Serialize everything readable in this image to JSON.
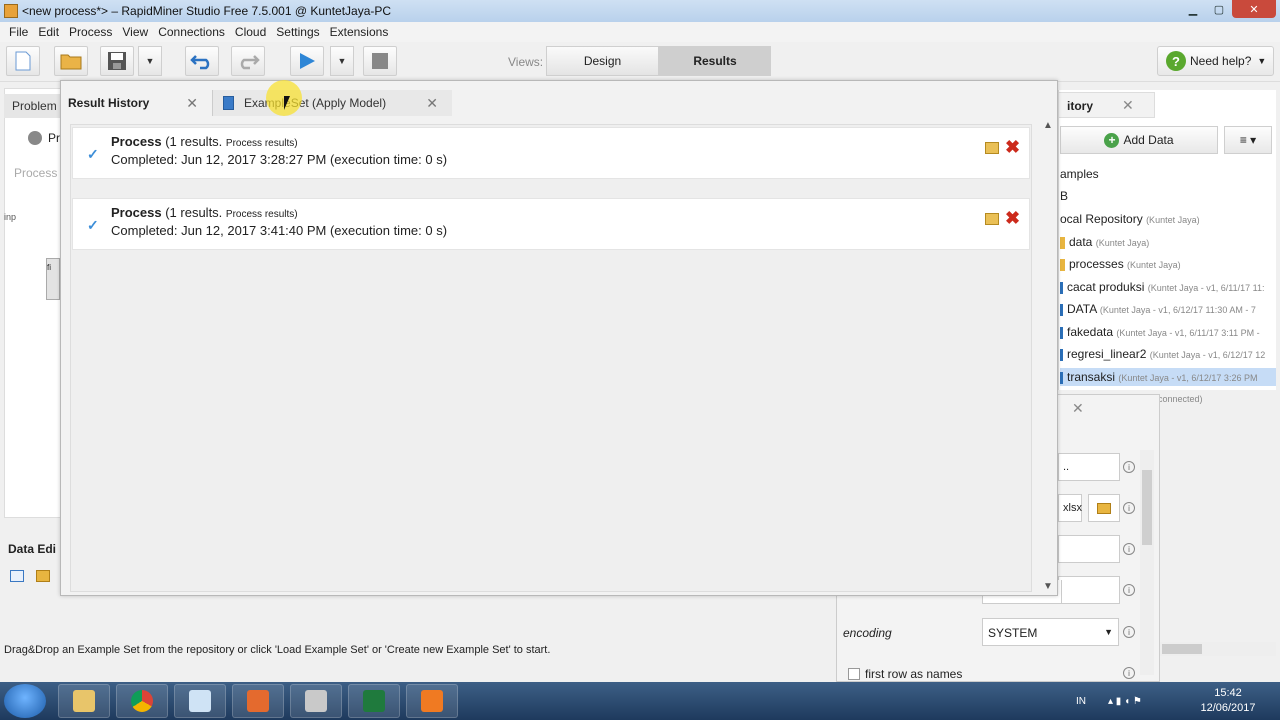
{
  "window": {
    "title": "<new process*> – RapidMiner Studio Free 7.5.001 @ KuntetJaya-PC",
    "controls": [
      "▁",
      "▢",
      "✕"
    ]
  },
  "menu": [
    "File",
    "Edit",
    "Process",
    "View",
    "Connections",
    "Cloud",
    "Settings",
    "Extensions"
  ],
  "toolbar": {
    "views_label": "Views:",
    "design_label": "Design",
    "results_label": "Results",
    "help_label": "Need help?"
  },
  "left_panel": {
    "tab_label": "Problem",
    "row_label": "Pr",
    "canvas_text": "Process",
    "port_label": "inp",
    "op_label": "fi"
  },
  "data_editor": {
    "title": "Data Edi",
    "status": "Drag&Drop an Example Set from the repository or click 'Load Example Set' or 'Create new Example Set' to start."
  },
  "result_history": {
    "tabs": [
      {
        "label": "Result History",
        "active": true
      },
      {
        "label": "ExampleSet (Apply Model)",
        "active": false
      }
    ],
    "entries": [
      {
        "name": "Process",
        "count_text": "(1 results.",
        "small_text": "Process results)",
        "completed": "Completed: Jun 12, 2017 3:28:27 PM (execution time: 0 s)"
      },
      {
        "name": "Process",
        "count_text": "(1 results.",
        "small_text": "Process results)",
        "completed": "Completed: Jun 12, 2017 3:41:40 PM (execution time: 0 s)"
      }
    ]
  },
  "repository": {
    "tab_label": "itory",
    "add_data_label": "Add Data",
    "items": [
      {
        "label": "amples",
        "meta": "",
        "kind": "none"
      },
      {
        "label": "B",
        "meta": "",
        "kind": "none"
      },
      {
        "label": "ocal Repository",
        "meta": "(Kuntet Jaya)",
        "kind": "none"
      },
      {
        "label": "data",
        "meta": "(Kuntet Jaya)",
        "kind": "folder"
      },
      {
        "label": "processes",
        "meta": "(Kuntet Jaya)",
        "kind": "folder"
      },
      {
        "label": "cacat produksi",
        "meta": "(Kuntet Jaya - v1, 6/11/17 11:",
        "kind": "data"
      },
      {
        "label": "DATA",
        "meta": "(Kuntet Jaya - v1, 6/12/17 11:30 AM - 7",
        "kind": "data"
      },
      {
        "label": "fakedata",
        "meta": "(Kuntet Jaya - v1, 6/11/17 3:11 PM -",
        "kind": "data"
      },
      {
        "label": "regresi_linear2",
        "meta": "(Kuntet Jaya - v1, 6/12/17 12",
        "kind": "data"
      },
      {
        "label": "transaksi",
        "meta": "(Kuntet Jaya - v1, 6/12/17 3:26 PM",
        "kind": "data",
        "selected": true
      }
    ],
    "connected_text": "connected)"
  },
  "params": {
    "field1": "..",
    "field2": "xlsx",
    "encoding_label": "encoding",
    "encoding_value": "SYSTEM",
    "first_row_label": "first row as names",
    "info_glyph": "i"
  },
  "taskbar": {
    "lang": "IN",
    "time": "15:42",
    "date": "12/06/2017"
  }
}
